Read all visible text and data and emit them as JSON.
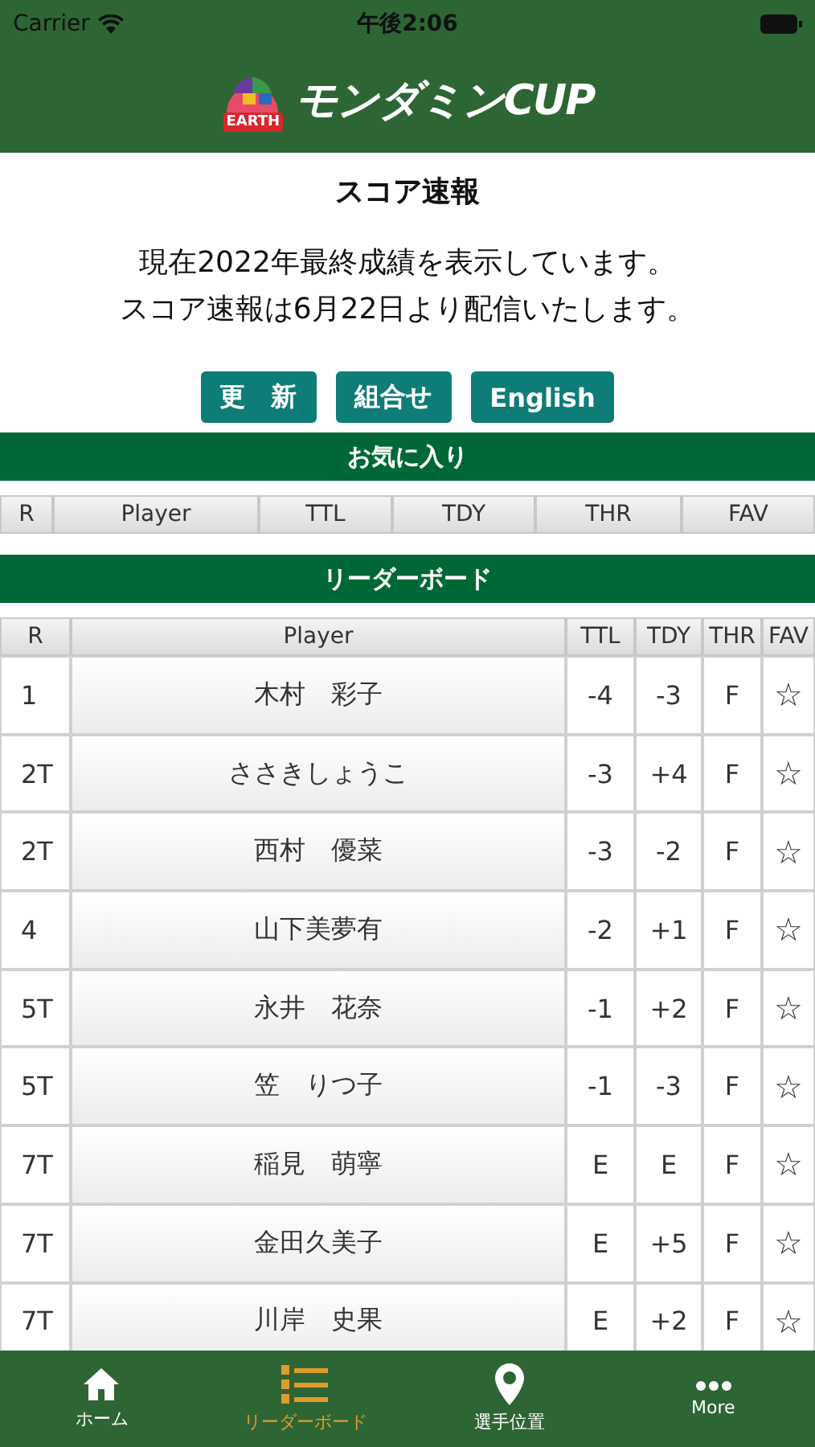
{
  "status_bar": {
    "carrier": "Carrier",
    "time": "午後2:06"
  },
  "header": {
    "logo_badge": "EARTH",
    "logo_title": "モンダミンCUP"
  },
  "notice": {
    "title": "スコア速報",
    "lines": [
      "現在2022年最終成績を表示しています。",
      "スコア速報は6月22日より配信いたします。"
    ]
  },
  "buttons": [
    "更　新",
    "組合せ",
    "English"
  ],
  "favorites": {
    "title": "お気に入り",
    "columns": [
      "R",
      "Player",
      "TTL",
      "TDY",
      "THR",
      "FAV"
    ]
  },
  "leaderboard": {
    "title": "リーダーボード",
    "columns": [
      "R",
      "Player",
      "TTL",
      "TDY",
      "THR",
      "FAV"
    ],
    "rows": [
      {
        "rank": "1",
        "player": "木村　彩子",
        "ttl": "-4",
        "tdy": "-3",
        "thr": "F",
        "fav": "☆",
        "favorite": false
      },
      {
        "rank": "2T",
        "player": "ささきしょうこ",
        "ttl": "-3",
        "tdy": "+4",
        "thr": "F",
        "fav": "☆",
        "favorite": false
      },
      {
        "rank": "2T",
        "player": "西村　優菜",
        "ttl": "-3",
        "tdy": "-2",
        "thr": "F",
        "fav": "☆",
        "favorite": false
      },
      {
        "rank": "4",
        "player": "山下美夢有",
        "ttl": "-2",
        "tdy": "+1",
        "thr": "F",
        "fav": "☆",
        "favorite": false
      },
      {
        "rank": "5T",
        "player": "永井　花奈",
        "ttl": "-1",
        "tdy": "+2",
        "thr": "F",
        "fav": "☆",
        "favorite": false
      },
      {
        "rank": "5T",
        "player": "笠　りつ子",
        "ttl": "-1",
        "tdy": "-3",
        "thr": "F",
        "fav": "☆",
        "favorite": false
      },
      {
        "rank": "7T",
        "player": "稲見　萌寧",
        "ttl": "E",
        "tdy": "E",
        "thr": "F",
        "fav": "☆",
        "favorite": false
      },
      {
        "rank": "7T",
        "player": "金田久美子",
        "ttl": "E",
        "tdy": "+5",
        "thr": "F",
        "fav": "☆",
        "favorite": false
      },
      {
        "rank": "7T",
        "player": "川岸　史果",
        "ttl": "E",
        "tdy": "+2",
        "thr": "F",
        "fav": "☆",
        "favorite": false
      }
    ]
  },
  "tab_bar": [
    {
      "label": "ホーム",
      "kind": "home",
      "selected": false
    },
    {
      "label": "リーダーボード",
      "kind": "ranking",
      "selected": true
    },
    {
      "label": "選手位置",
      "kind": "location",
      "selected": false
    },
    {
      "label": "More",
      "kind": "more",
      "selected": false
    }
  ]
}
